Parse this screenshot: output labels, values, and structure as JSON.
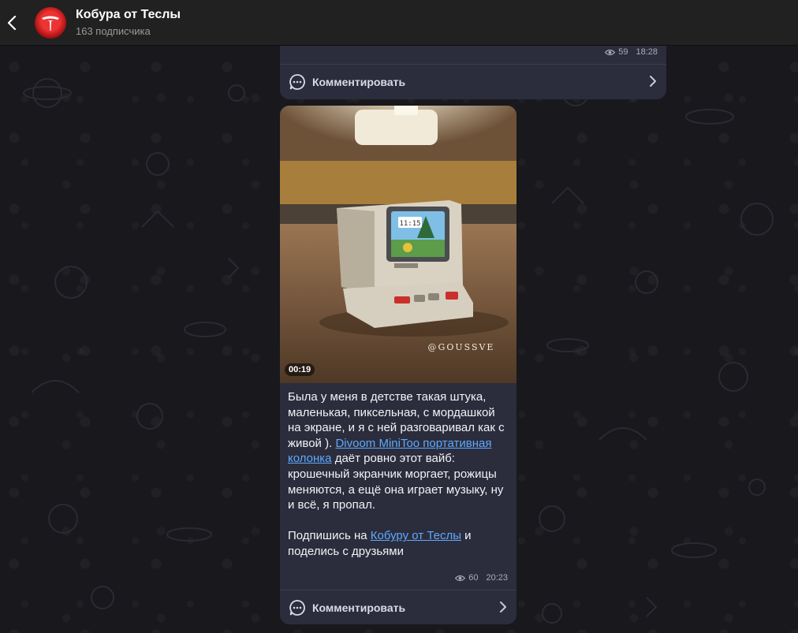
{
  "header": {
    "title": "Кобура от Теслы",
    "subtitle": "163 подписчика"
  },
  "previous_post": {
    "views": "59",
    "time": "18:28",
    "comment_label": "Комментировать"
  },
  "post": {
    "duration": "00:19",
    "watermark": "@GOUSSVE",
    "screen_time": "11:15",
    "text_before_link": "Была у меня в детстве такая штука, маленькая, пиксельная, с мордашкой на экране, и я с ней разговаривал как с живой ). ",
    "link_product": "Divoom MiniToo портативная колонка",
    "text_after_link": " даёт ровно этот вайб: крошечный экранчик моргает, рожицы меняются, а ещё она играет музыку, ну и всё, я пропал.",
    "subscribe_before": "Подпишись на ",
    "subscribe_link": "Кобуру от Теслы",
    "subscribe_after": " и поделись с друзьями",
    "views": "60",
    "time": "20:23",
    "comment_label": "Комментировать"
  },
  "colors": {
    "bubble": "#2b2d3c",
    "link": "#5ea9ff",
    "header": "#212121",
    "avatar": "#c8161b"
  }
}
